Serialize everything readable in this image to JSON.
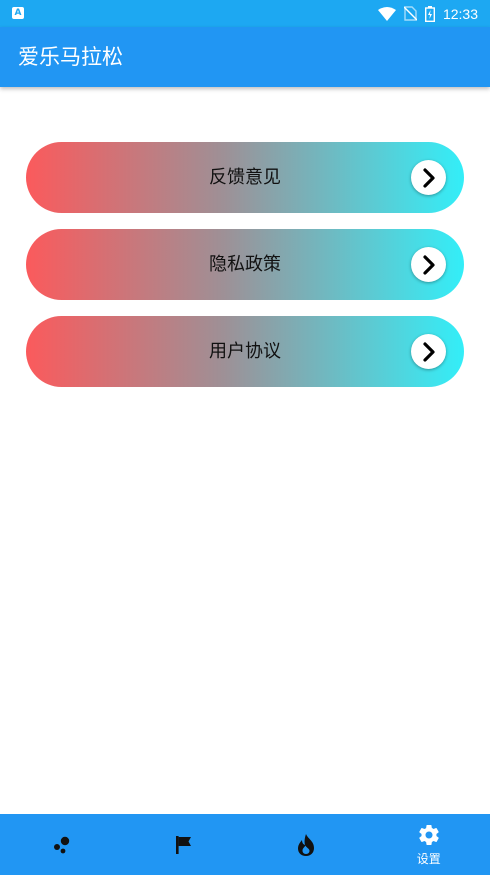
{
  "status_bar": {
    "app_icon_letter": "A",
    "time": "12:33"
  },
  "app_bar": {
    "title": "爱乐马拉松"
  },
  "menu": {
    "items": [
      {
        "label": "反馈意见",
        "icon": "chevron-right-icon"
      },
      {
        "label": "隐私政策",
        "icon": "chevron-right-icon"
      },
      {
        "label": "用户协议",
        "icon": "chevron-right-icon"
      }
    ]
  },
  "bottom_nav": {
    "items": [
      {
        "icon": "dots-icon",
        "label": ""
      },
      {
        "icon": "flag-icon",
        "label": ""
      },
      {
        "icon": "flame-icon",
        "label": ""
      },
      {
        "icon": "gear-icon",
        "label": "设置",
        "active": true
      }
    ]
  },
  "colors": {
    "status_bar": "#1da8f2",
    "app_bar": "#2196f3",
    "gradient_start": "#fb5a5c",
    "gradient_end": "#33eef8"
  }
}
